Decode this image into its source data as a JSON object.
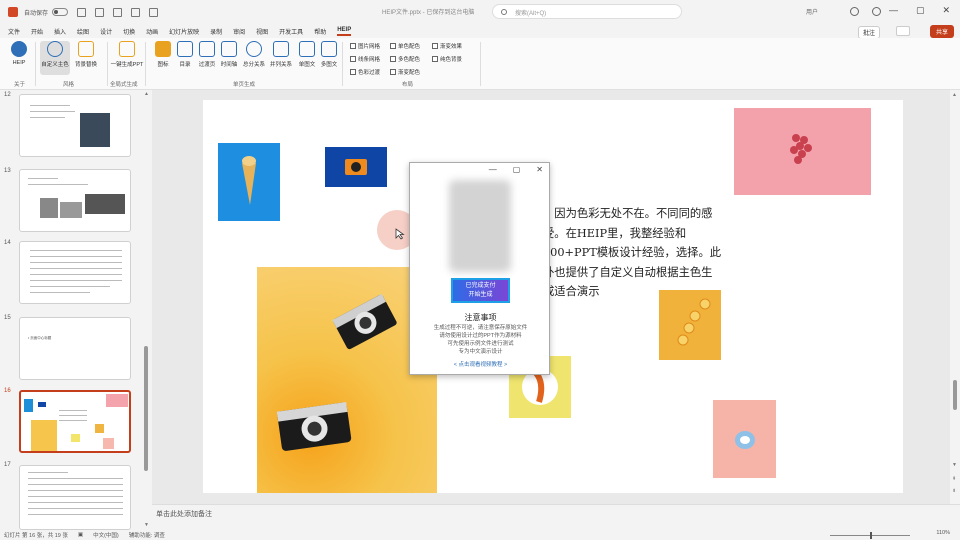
{
  "titlebar": {
    "autosave_label": "自动保存",
    "filename": "HEIP文件.pptx - 已保存到这台电脑",
    "search_placeholder": "搜索(Alt+Q)",
    "user": "用户",
    "controls": [
      "—",
      "▢",
      "✕"
    ]
  },
  "menu": {
    "tabs": [
      "文件",
      "开始",
      "插入",
      "绘图",
      "设计",
      "切换",
      "动画",
      "幻灯片放映",
      "录制",
      "审阅",
      "视图",
      "开发工具",
      "帮助",
      "HEIP"
    ],
    "active_tab": "HEIP",
    "comment": "批注",
    "share": "共享"
  },
  "ribbon": {
    "buttons": [
      "HEIP",
      "自定义主色",
      "背景替换",
      "一键生成PPT",
      "图标",
      "目录",
      "过渡页",
      "时间轴",
      "总分关系",
      "并列关系",
      "单图文",
      "多图文"
    ],
    "groups": [
      "关于",
      "风格",
      "全局式生成",
      "单页生成",
      "布局"
    ],
    "checkboxes": [
      "图片网格",
      "单色配色",
      "渐变效果",
      "线条网格",
      "多色配色",
      "纯色背景",
      "色彩过渡",
      "渐变配色"
    ]
  },
  "sidebar": {
    "slide_numbers": [
      "12",
      "13",
      "14",
      "15",
      "16",
      "17"
    ],
    "slide15_text": "• 页面中心标题"
  },
  "slide": {
    "body_text": "，因为色彩无处不在。不同同的感受。在HEIP里，我整经验和200+PPT模板设计经验，选择。此外也提供了自定义自动根据主色生成适合演示"
  },
  "dialog": {
    "button": "已完成支付\n开始生成",
    "notice_title": "注意事项",
    "notice_lines": [
      "生成过程不可逆，请注意保存原始文件",
      "请勿使用设计过的PPT作为源材料",
      "可先使用示例文件进行测试",
      "专为中文演示设计"
    ],
    "link": "< 点击观看视频教程 >"
  },
  "notes": {
    "placeholder": "单击此处添加备注"
  },
  "status": {
    "slide_info": "幻灯片 第 16 张，共 19 张",
    "language": "中文(中国)",
    "accessibility": "辅助功能: 调查",
    "zoom": "110%"
  },
  "colors": {
    "accent": "#c43e1c",
    "heip_blue": "#2e6fb7"
  }
}
